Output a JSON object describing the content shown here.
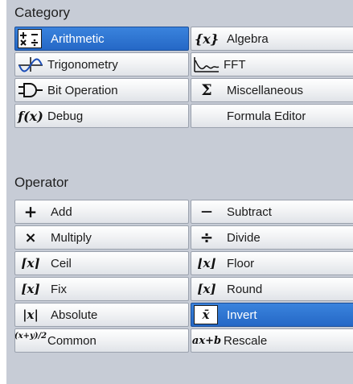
{
  "category": {
    "title": "Category",
    "items": [
      {
        "label": "Arithmetic",
        "icon": "arithmetic-icon",
        "selected": true
      },
      {
        "label": "Algebra",
        "icon": "algebra-icon",
        "icon_text": "{x}"
      },
      {
        "label": "Trigonometry",
        "icon": "sine-wave-icon"
      },
      {
        "label": "FFT",
        "icon": "fft-icon"
      },
      {
        "label": "Bit Operation",
        "icon": "logic-gate-icon"
      },
      {
        "label": "Miscellaneous",
        "icon": "sigma-icon",
        "icon_text": "Σ"
      },
      {
        "label": "Debug",
        "icon": "function-icon",
        "icon_text": "f(x)"
      },
      {
        "label": "Formula Editor",
        "icon": "none"
      }
    ]
  },
  "operator": {
    "title": "Operator",
    "items": [
      {
        "label": "Add",
        "icon": "plus-icon",
        "icon_text": "+"
      },
      {
        "label": "Subtract",
        "icon": "minus-icon",
        "icon_text": "—"
      },
      {
        "label": "Multiply",
        "icon": "multiply-icon",
        "icon_text": "×"
      },
      {
        "label": "Divide",
        "icon": "divide-icon",
        "icon_text": "÷"
      },
      {
        "label": "Ceil",
        "icon": "ceil-icon",
        "icon_text": "⌈x⌉"
      },
      {
        "label": "Floor",
        "icon": "floor-icon",
        "icon_text": "⌊x⌋"
      },
      {
        "label": "Fix",
        "icon": "fix-icon",
        "icon_text": "[x]"
      },
      {
        "label": "Round",
        "icon": "round-icon",
        "icon_text": "[x]"
      },
      {
        "label": "Absolute",
        "icon": "absolute-icon",
        "icon_text": "|x|"
      },
      {
        "label": "Invert",
        "icon": "invert-icon",
        "icon_text": "x̄",
        "selected": true
      },
      {
        "label": "Common",
        "icon": "common-icon",
        "icon_text": "(x+y)/2"
      },
      {
        "label": "Rescale",
        "icon": "rescale-icon",
        "icon_text": "ax+b"
      }
    ]
  },
  "colors": {
    "panel_background": "#c7ccd6",
    "selected_background": "#2568c6",
    "button_background": "#f2f3f5"
  }
}
